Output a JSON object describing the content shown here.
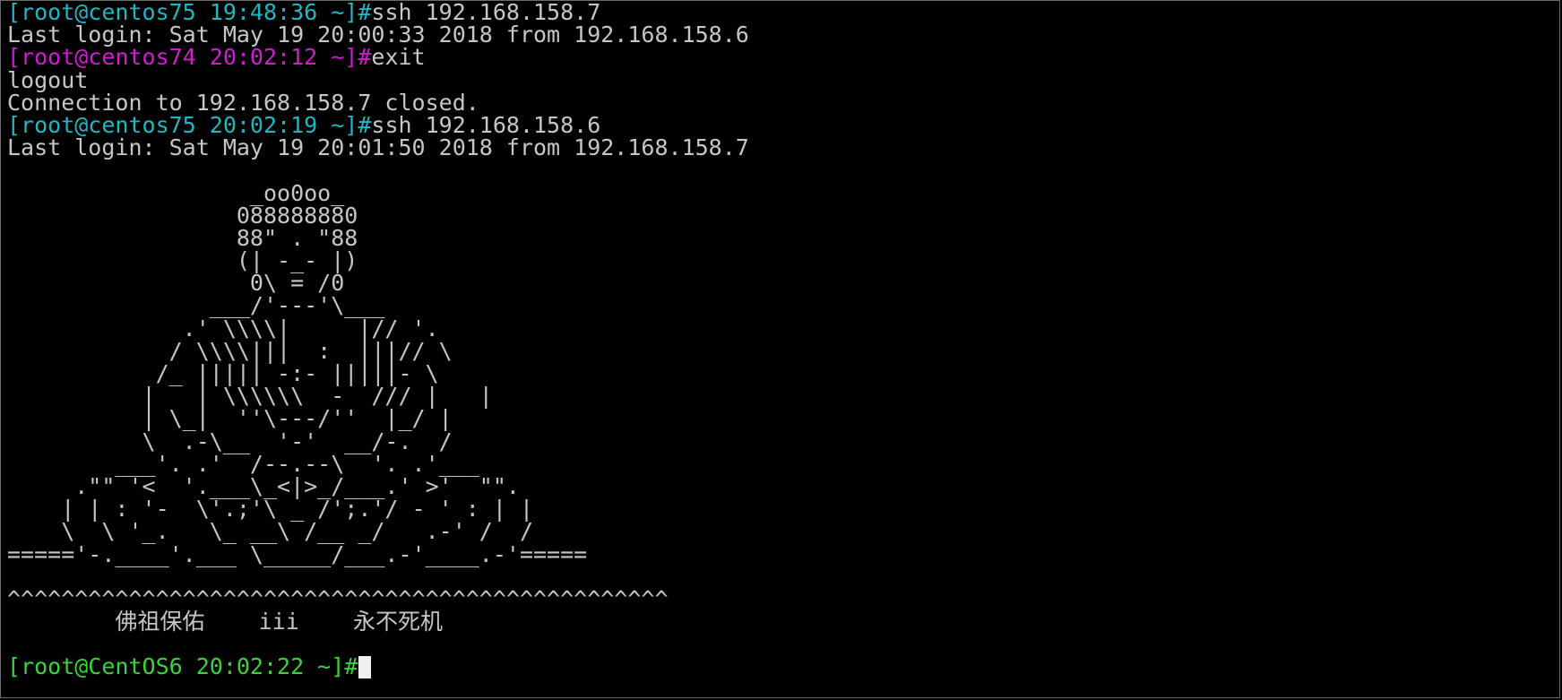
{
  "session": [
    {
      "prompt": "[root@centos75 19:48:36 ~]#",
      "prompt_color": "#1fb7c4",
      "command": "ssh 192.168.158.7"
    },
    {
      "output": "Last login: Sat May 19 20:00:33 2018 from 192.168.158.6"
    },
    {
      "prompt": "[root@centos74 20:02:12 ~]#",
      "prompt_color": "#d31ad3",
      "command": "exit"
    },
    {
      "output": "logout"
    },
    {
      "output": "Connection to 192.168.158.7 closed."
    },
    {
      "prompt": "[root@centos75 20:02:19 ~]#",
      "prompt_color": "#1fb7c4",
      "command": "ssh 192.168.158.6"
    },
    {
      "output": "Last login: Sat May 19 20:01:50 2018 from 192.168.158.7"
    }
  ],
  "banner": [
    "",
    "                  _oo0oo_",
    "                 088888880",
    "                 88\" . \"88",
    "                 (| -_- |)",
    "                  0\\ = /0",
    "               ___/'---'\\___",
    "             .' \\\\\\\\|     |// '.",
    "            / \\\\\\\\|||  :  |||// \\",
    "           /_ ||||| -:- |||||- \\",
    "          |   | \\\\\\\\\\\\  -  /// |   |",
    "          | \\_|  ''\\---/''  |_/ |",
    "          \\  .-\\__  '-'  __/-.  /",
    "        ___'. .'  /--.--\\  '. .'___",
    "     .\"\" '<  '.___\\_<|>_/___.' >'  \"\".",
    "    | | : '-  \\'.;'\\ _ /';.'/ - ' : | |",
    "    \\  \\ '_.   \\_ __\\ /__ _/   .-' /  /",
    "====='-.____'.___ \\_____/___.-'____.-'=====",
    "",
    "^^^^^^^^^^^^^^^^^^^^^^^^^^^^^^^^^^^^^^^^^^^^^^^^^",
    "        佛祖保佑    iii    永不死机",
    ""
  ],
  "current_prompt": {
    "text": "[root@CentOS6 20:02:22 ~]#",
    "color": "#37d43b"
  }
}
